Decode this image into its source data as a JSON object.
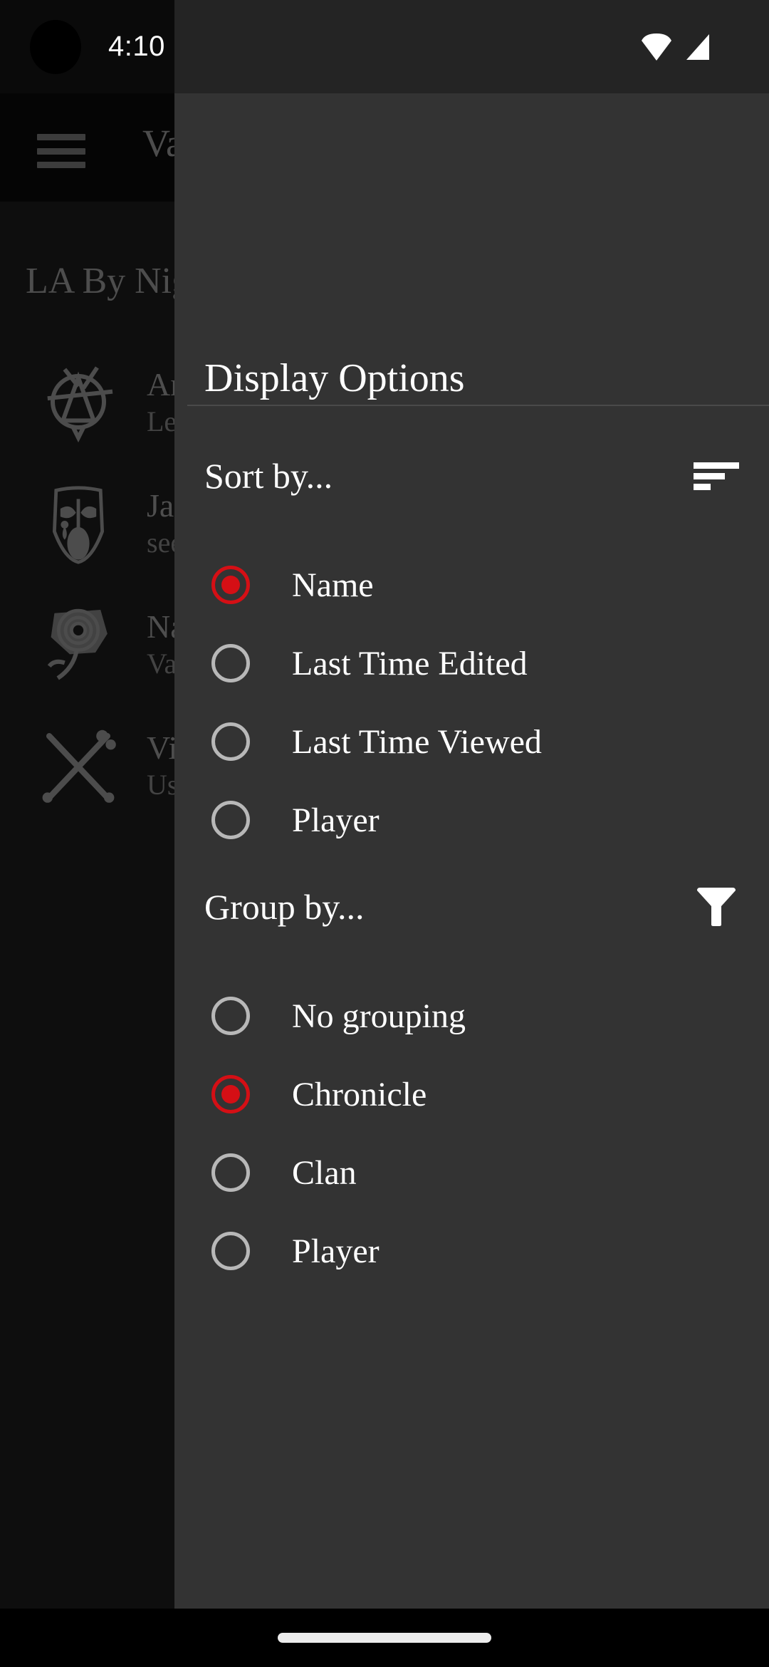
{
  "status_bar": {
    "time": "4:10",
    "wifi_icon": "wifi-icon",
    "signal_icon": "cellular-signal-icon"
  },
  "background_app": {
    "menu_icon": "hamburger-menu-icon",
    "app_title": "Vampire",
    "section_header": "LA By Night",
    "list_items": [
      {
        "symbol": "anarch-clan-symbol",
        "primary": "Anarch",
        "secondary": "Legacy"
      },
      {
        "symbol": "malkavian-clan-symbol",
        "primary": "Jasper",
        "secondary": "seer"
      },
      {
        "symbol": "toreador-clan-symbol",
        "primary": "Nadia",
        "secondary": "Valkyrie"
      },
      {
        "symbol": "ventrue-clan-symbol",
        "primary": "Victor",
        "secondary": "Usurper"
      }
    ]
  },
  "drawer": {
    "title": "Display Options",
    "sort_section": {
      "label": "Sort by...",
      "icon": "sort-descending-icon",
      "options": [
        {
          "label": "Name",
          "selected": true
        },
        {
          "label": "Last Time Edited",
          "selected": false
        },
        {
          "label": "Last Time Viewed",
          "selected": false
        },
        {
          "label": "Player",
          "selected": false
        }
      ]
    },
    "group_section": {
      "label": "Group by...",
      "icon": "filter-funnel-icon",
      "options": [
        {
          "label": "No grouping",
          "selected": false
        },
        {
          "label": "Chronicle",
          "selected": true
        },
        {
          "label": "Clan",
          "selected": false
        },
        {
          "label": "Player",
          "selected": false
        }
      ]
    }
  },
  "nav_bar": {
    "gesture_pill": "gesture-navigation-pill"
  },
  "colors": {
    "accent_red": "#d50f15",
    "drawer_background": "#333333",
    "app_background": "#1a1a1a",
    "text_primary": "#ffffff",
    "radio_unselected": "#b8b8b8"
  }
}
